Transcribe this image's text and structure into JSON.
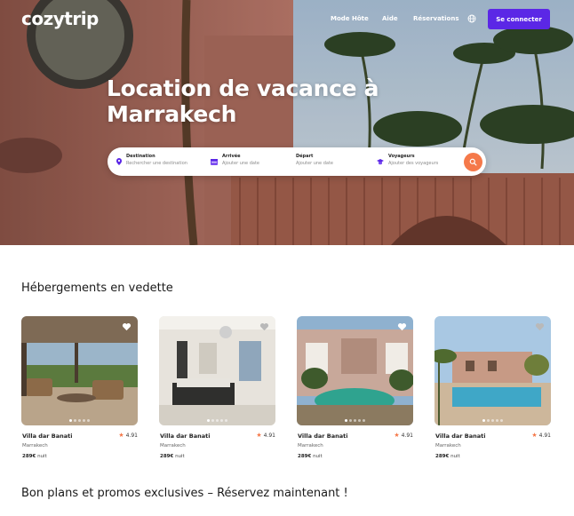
{
  "brand": {
    "logo_text": "cozytrip"
  },
  "nav": {
    "host_mode": "Mode Hôte",
    "help": "Aide",
    "bookings": "Réservations",
    "login": "Se connecter"
  },
  "hero": {
    "title": "Location de vacance à Marrakech"
  },
  "search": {
    "fields": [
      {
        "label": "Destination",
        "placeholder": "Rechercher une destination",
        "icon": "location-pin-icon"
      },
      {
        "label": "Arrivée",
        "placeholder": "Ajouter une date",
        "icon": "calendar-icon"
      },
      {
        "label": "Départ",
        "placeholder": "Ajouter une date",
        "icon": ""
      },
      {
        "label": "Voyageurs",
        "placeholder": "Ajouter des voyageurs",
        "icon": "travelers-icon"
      }
    ],
    "button_icon": "search-icon"
  },
  "featured": {
    "title": "Hébergements en vedette",
    "listings": [
      {
        "name": "Villa dar Banati",
        "rating": "4.91",
        "city": "Marrakech",
        "price": "289€",
        "unit": "nuit"
      },
      {
        "name": "Villa dar Banati",
        "rating": "4.91",
        "city": "Marrakech",
        "price": "289€",
        "unit": "nuit"
      },
      {
        "name": "Villa dar Banati",
        "rating": "4.91",
        "city": "Marrakech",
        "price": "289€",
        "unit": "nuit"
      },
      {
        "name": "Villa dar Banati",
        "rating": "4.91",
        "city": "Marrakech",
        "price": "289€",
        "unit": "nuit"
      }
    ]
  },
  "promos": {
    "title": "Bon plans et promos exclusives – Réservez maintenant !"
  },
  "colors": {
    "accent": "#5b27e6",
    "search_button": "#f5794a",
    "star": "#f5794a"
  }
}
